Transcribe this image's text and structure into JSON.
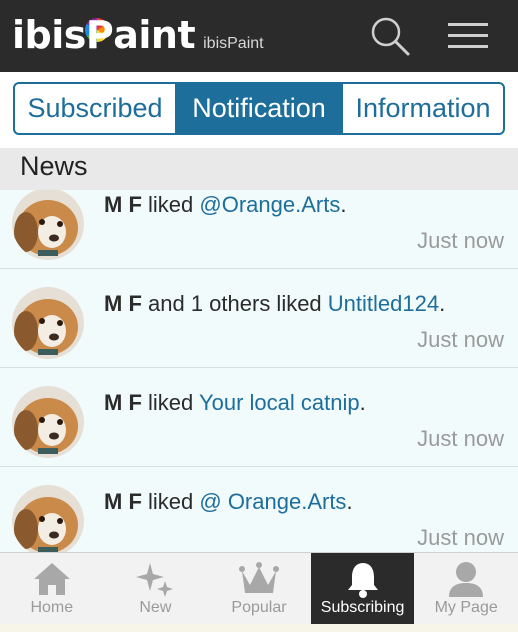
{
  "header": {
    "logo_text_left": "ibis",
    "logo_text_p": "P",
    "logo_text_right": "aint",
    "logo_sub": "ibisPaint",
    "search_icon": "search-icon",
    "menu_icon": "hamburger-menu-icon"
  },
  "segments": {
    "subscribed": "Subscribed",
    "notification": "Notification",
    "information": "Information",
    "selected": "Notification"
  },
  "section": {
    "title": "News"
  },
  "feed": [
    {
      "user": "M F",
      "action": " liked ",
      "target": "@Orange.Arts",
      "end": ".",
      "time": "Just now"
    },
    {
      "user": "M F",
      "action": " and 1 others liked ",
      "target": "Untitled124",
      "end": ".",
      "time": "Just now"
    },
    {
      "user": "M F",
      "action": " liked ",
      "target": "Your local catnip",
      "end": ".",
      "time": "Just now"
    },
    {
      "user": "M F",
      "action": " liked ",
      "target": "@ Orange.Arts",
      "end": ".",
      "time": "Just now"
    }
  ],
  "tabs": [
    {
      "label": "Home",
      "icon": "home-icon"
    },
    {
      "label": "New",
      "icon": "sparkle-icon"
    },
    {
      "label": "Popular",
      "icon": "crown-icon"
    },
    {
      "label": "Subscribing",
      "icon": "bell-icon",
      "active": true
    },
    {
      "label": "My Page",
      "icon": "person-icon"
    }
  ],
  "colors": {
    "header_bg": "#2b2b2b",
    "accent": "#1e6e9c",
    "feed_bg": "#f1fbfb",
    "section_bg": "#e9e9e9"
  }
}
